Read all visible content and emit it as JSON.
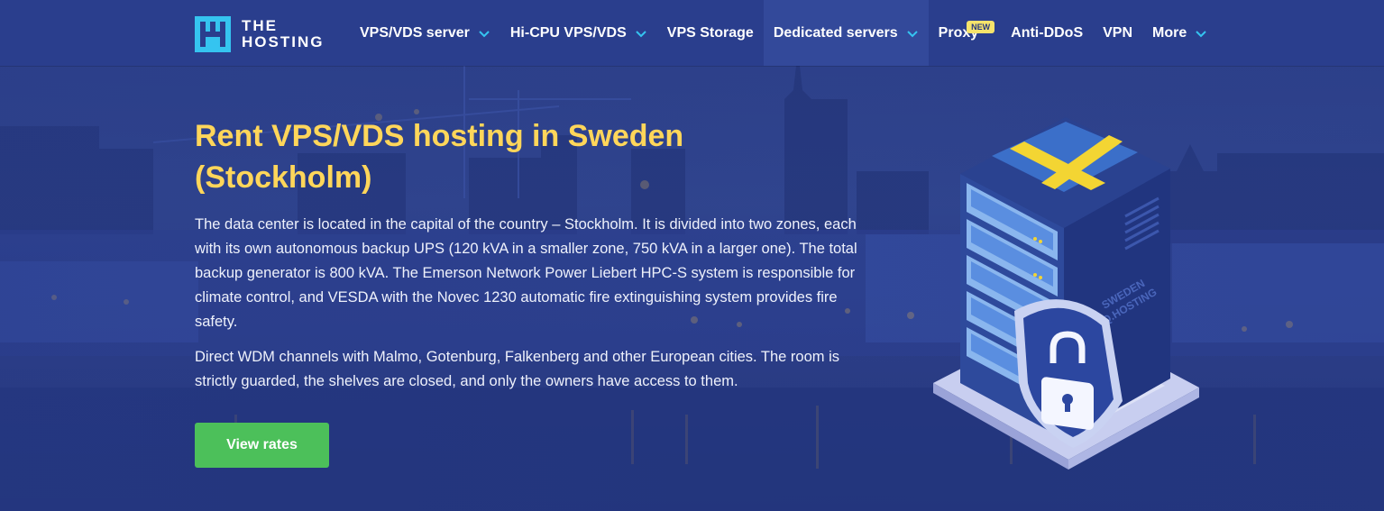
{
  "brand": {
    "line1": "THE",
    "line2": "HOSTING"
  },
  "nav": [
    {
      "label": "VPS/VDS server",
      "dropdown": true
    },
    {
      "label": "Hi-CPU VPS/VDS",
      "dropdown": true
    },
    {
      "label": "VPS Storage",
      "dropdown": false
    },
    {
      "label": "Dedicated servers",
      "dropdown": true
    },
    {
      "label": "Proxy",
      "badge": "NEW",
      "dropdown": false
    },
    {
      "label": "Anti-DDoS",
      "dropdown": false
    },
    {
      "label": "VPN",
      "dropdown": false
    },
    {
      "label": "More",
      "dropdown": true
    }
  ],
  "hero": {
    "title_line1": "Rent VPS/VDS hosting in Sweden",
    "title_line2": "(Stockholm)",
    "paragraph1": "The data center is located in the capital of the country – Stockholm. It is divided into two zones, each with its own autonomous backup UPS (120 kVA in a smaller zone, 750 kVA in a larger one). The total backup generator is 800 kVA. The Emerson Network Power Liebert HPC-S system is responsible for climate control, and VESDA with the Novec 1230 automatic fire extinguishing system provides fire safety.",
    "paragraph2": "Direct WDM channels with Malmo, Gotenburg, Falkenberg and other European cities. The room is strictly guarded, the shelves are closed, and only the owners have access to them.",
    "cta_label": "View rates"
  },
  "illustration": {
    "server_text_line1": "SWEDEN",
    "server_text_line2": "PQ.HOSTING"
  },
  "colors": {
    "header_bg": "#2a3e8d",
    "title": "#ffd65a",
    "cta": "#4cc05a",
    "chevron": "#35c4f0",
    "badge": "#f6e36b",
    "flag_blue": "#3b6fc9",
    "flag_yellow": "#f3d533"
  },
  "icons": [
    "logo-mark",
    "chevron-down-icon",
    "lock-icon",
    "shield-icon",
    "server-rack-icon"
  ]
}
